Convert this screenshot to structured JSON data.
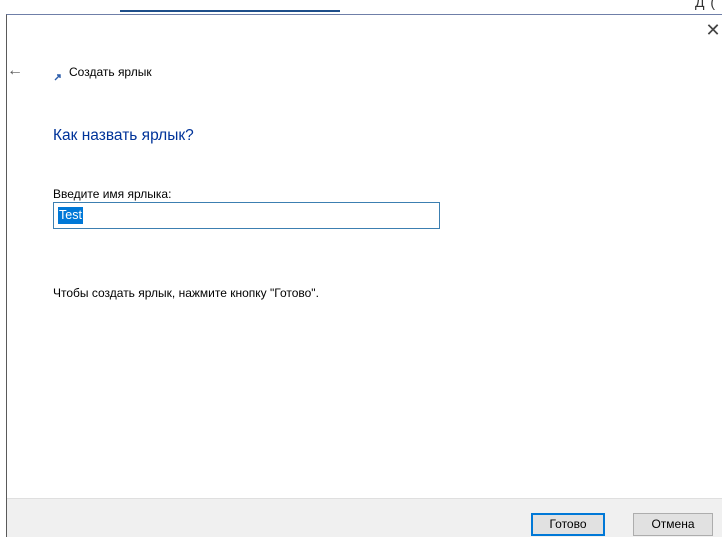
{
  "background_window": {
    "partial_text": "Д  ("
  },
  "wizard": {
    "title": "Создать ярлык",
    "close_glyph": "✕",
    "back_glyph": "←"
  },
  "page": {
    "heading": "Как назвать ярлык?",
    "name_label": "Введите имя ярлыка:",
    "name_value": "Test",
    "hint": "Чтобы создать ярлык, нажмите кнопку \"Готово\"."
  },
  "footer": {
    "finish_label": "Готово",
    "cancel_label": "Отмена"
  },
  "colors": {
    "heading": "#003399",
    "selection": "#0078d7",
    "footer_bg": "#f0f0f0"
  }
}
